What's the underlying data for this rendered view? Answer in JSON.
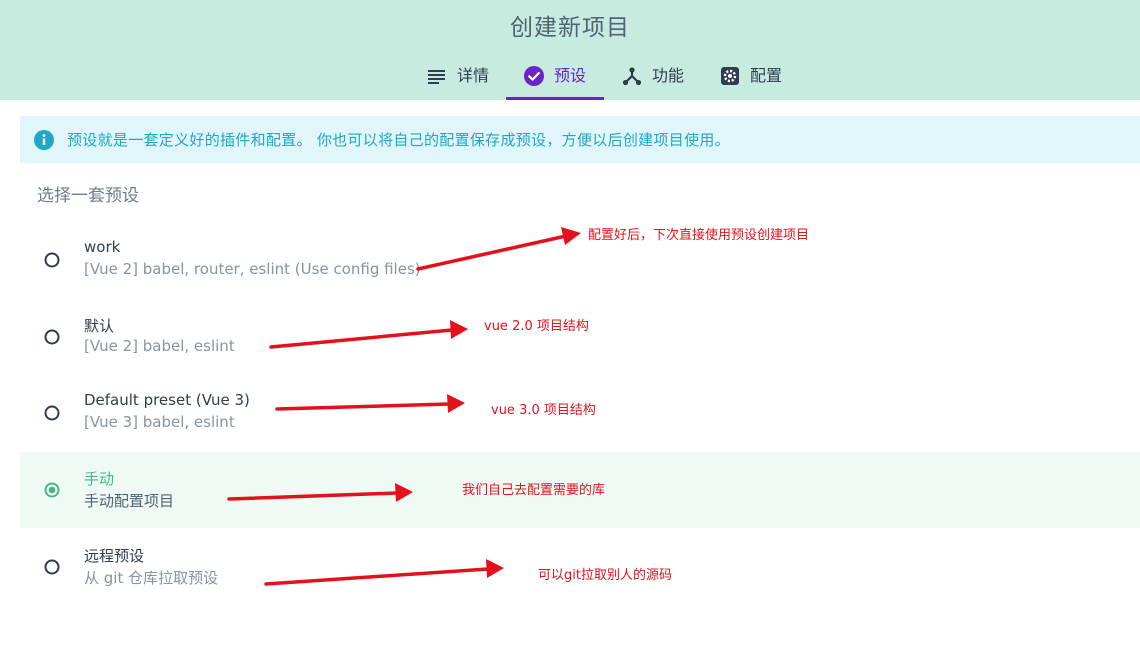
{
  "header": {
    "title": "创建新项目",
    "tabs": [
      {
        "label": "详情",
        "icon": "list-icon",
        "active": false
      },
      {
        "label": "预设",
        "icon": "check-circle-icon",
        "active": true
      },
      {
        "label": "功能",
        "icon": "branch-icon",
        "active": false
      },
      {
        "label": "配置",
        "icon": "gear-icon",
        "active": false
      }
    ],
    "accent_color": "#6a23c9",
    "background": "#c8ebdf"
  },
  "info": {
    "icon": "info-icon",
    "text": "预设就是一套定义好的插件和配置。 你也可以将自己的配置保存成预设，方便以后创建项目使用。"
  },
  "section": {
    "title": "选择一套预设"
  },
  "presets": [
    {
      "name": "work",
      "description": "[Vue 2] babel, router, eslint (Use config files)",
      "selected": false
    },
    {
      "name": "默认",
      "description": "[Vue 2] babel, eslint",
      "selected": false
    },
    {
      "name": "Default preset (Vue 3)",
      "description": "[Vue 3] babel, eslint",
      "selected": false
    },
    {
      "name": "手动",
      "description": "手动配置项目",
      "selected": true
    },
    {
      "name": "远程预设",
      "description": "从 git 仓库拉取预设",
      "selected": false
    }
  ],
  "annotations": [
    {
      "text": "配置好后，下次直接使用预设创建项目"
    },
    {
      "text": "vue  2.0  项目结构"
    },
    {
      "text": "vue  3.0  项目结构"
    },
    {
      "text": "我们自己去配置需要的库"
    },
    {
      "text": "可以git拉取别人的源码"
    }
  ],
  "annotation_color": "#e4101c",
  "selected_color": "#42b983"
}
